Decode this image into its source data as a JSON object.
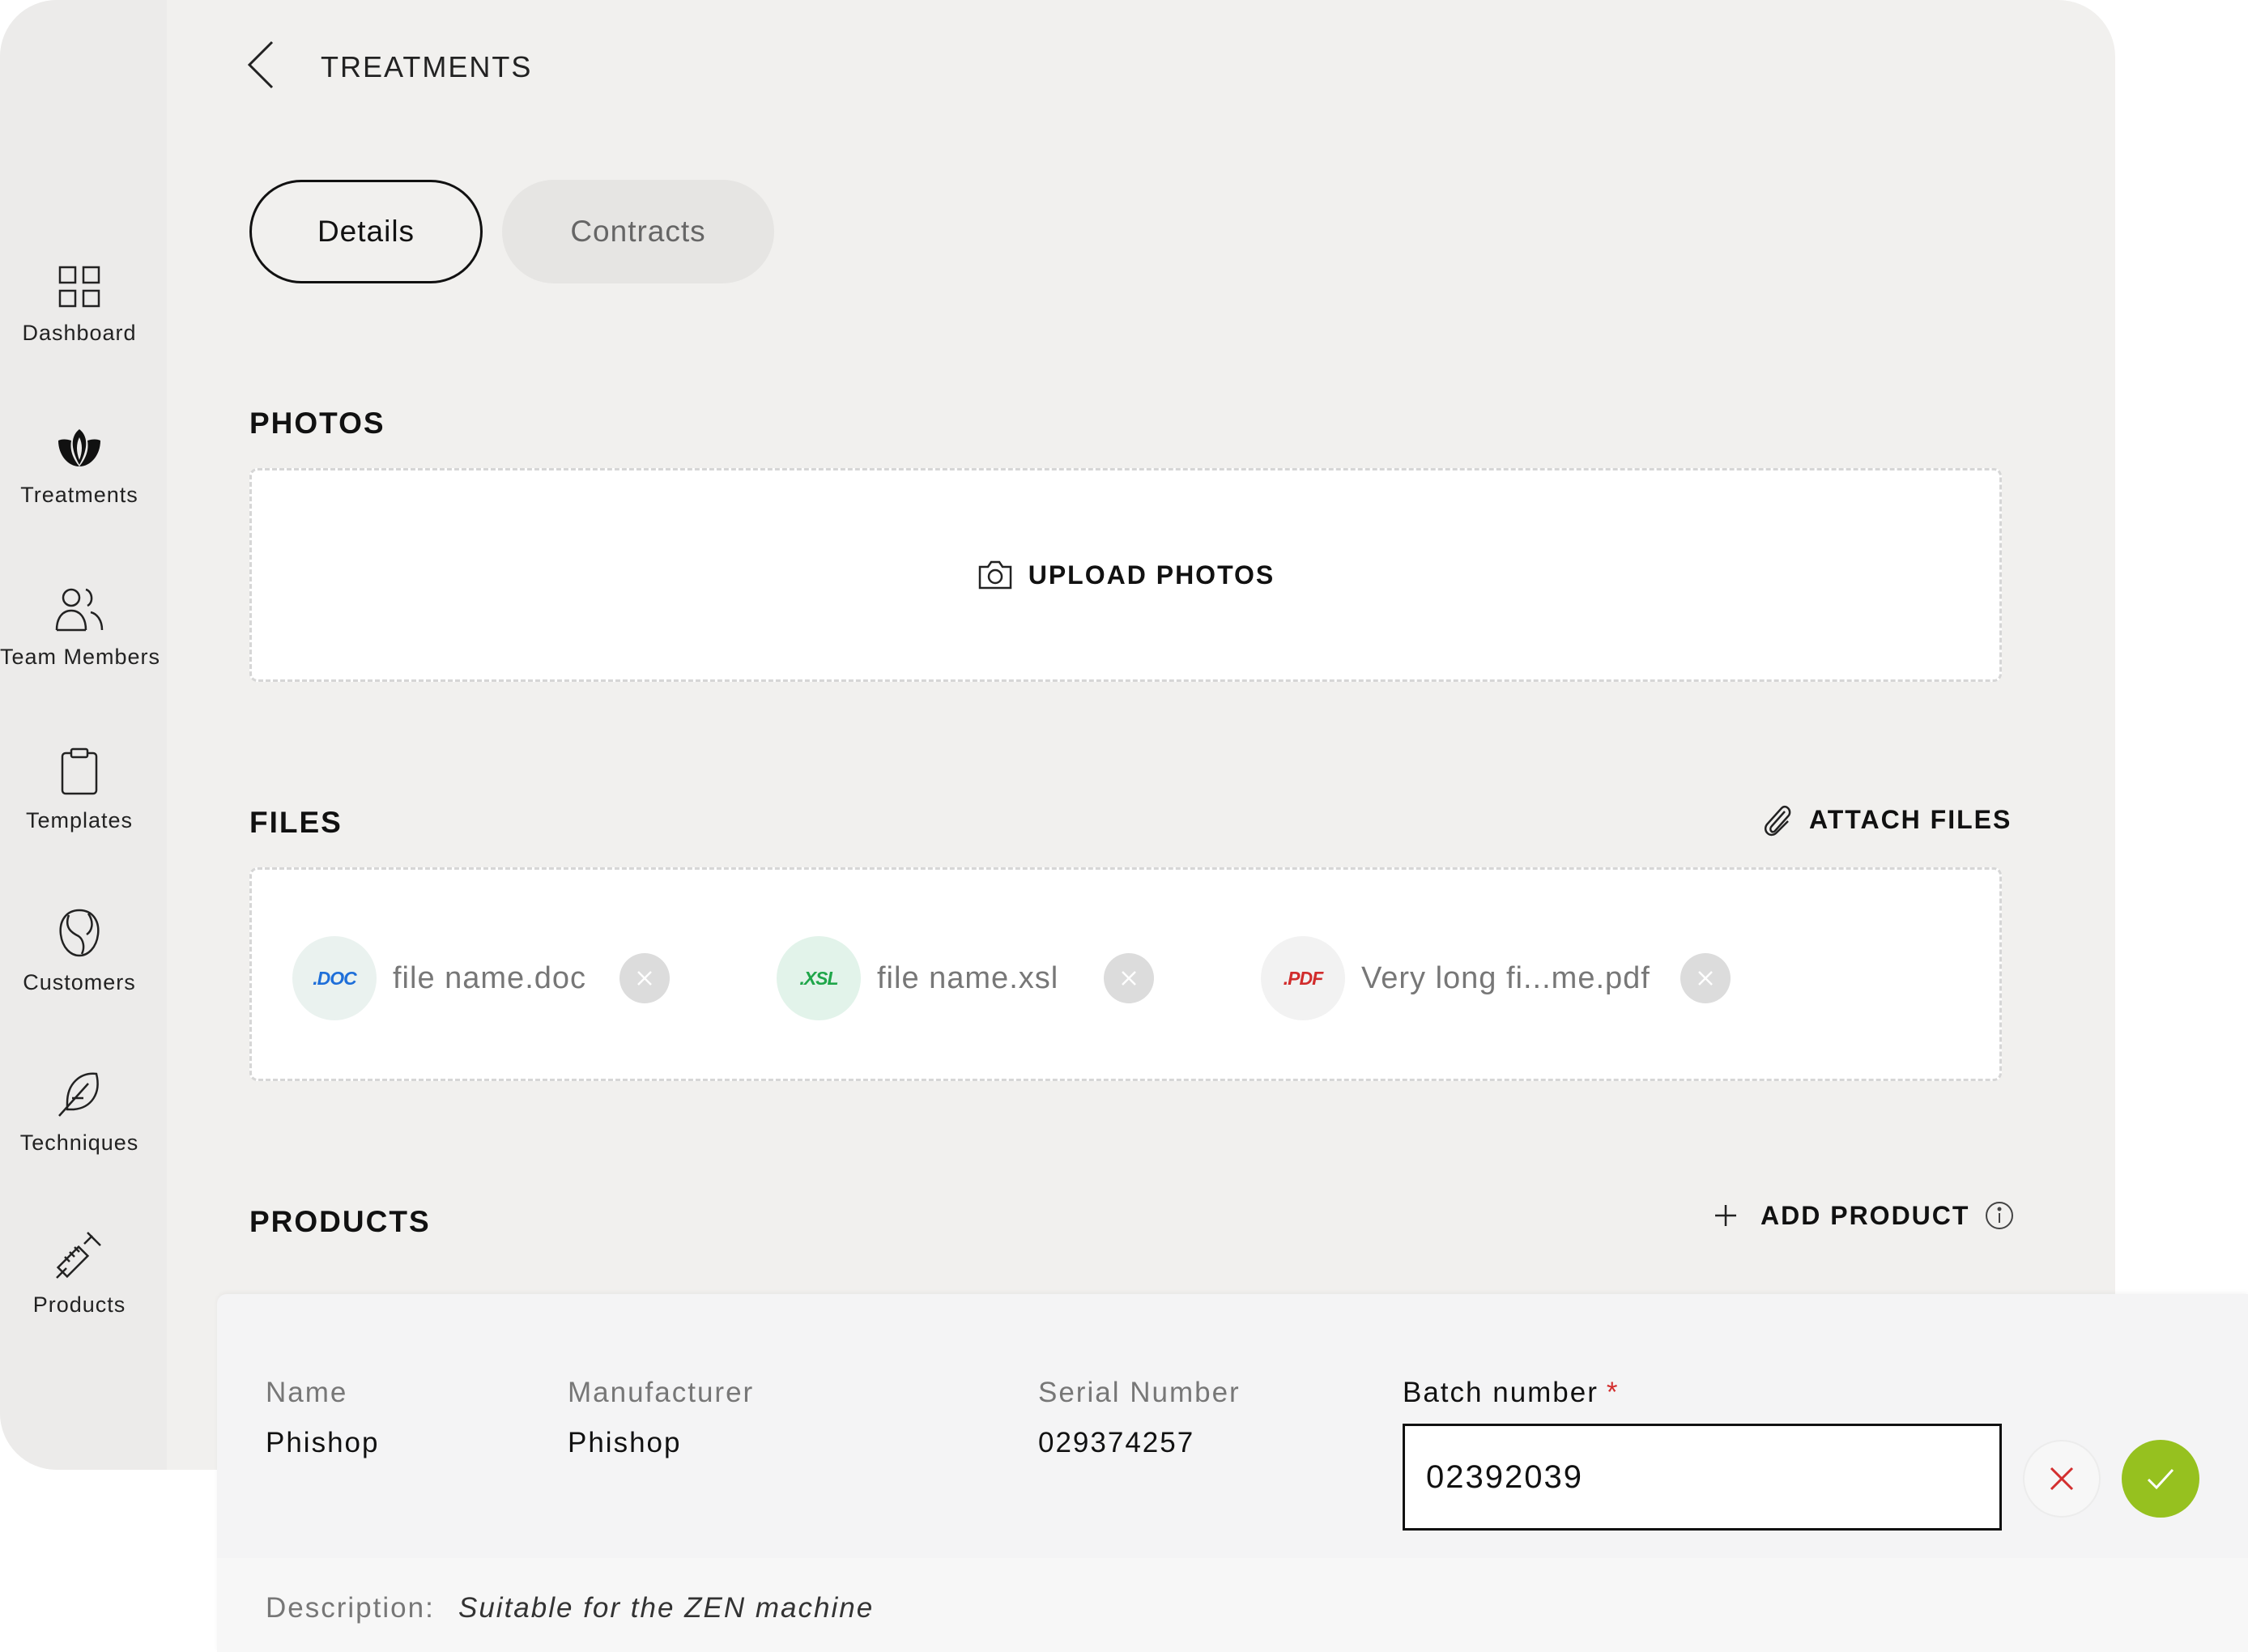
{
  "header": {
    "title": "TREATMENTS"
  },
  "sidebar": {
    "items": [
      {
        "label": "Dashboard",
        "icon": "grid-icon"
      },
      {
        "label": "Treatments",
        "icon": "lotus-icon"
      },
      {
        "label": "Team Members",
        "icon": "users-icon"
      },
      {
        "label": "Templates",
        "icon": "clipboard-icon"
      },
      {
        "label": "Customers",
        "icon": "face-icon"
      },
      {
        "label": "Techniques",
        "icon": "feather-icon"
      },
      {
        "label": "Products",
        "icon": "syringe-icon"
      }
    ]
  },
  "tabs": [
    {
      "label": "Details",
      "active": true
    },
    {
      "label": "Contracts",
      "active": false
    }
  ],
  "photos": {
    "title": "PHOTOS",
    "upload_label": "UPLOAD PHOTOS"
  },
  "files": {
    "title": "FILES",
    "attach_label": "ATTACH FILES",
    "items": [
      {
        "badge": ".DOC",
        "name": "file name.doc",
        "color": "#1e6fd9",
        "bg": "#eaf2ef"
      },
      {
        "badge": ".XSL",
        "name": "file name.xsl",
        "color": "#1fa64a",
        "bg": "#e2f3ea"
      },
      {
        "badge": ".PDF",
        "name": "Very long fi...me.pdf",
        "color": "#d12c2c",
        "bg": "#f2f2f2"
      }
    ]
  },
  "products": {
    "title": "PRODUCTS",
    "add_label": "ADD PRODUCT",
    "columns": {
      "name": "Name",
      "manufacturer": "Manufacturer",
      "serial": "Serial Number",
      "batch": "Batch number"
    },
    "row": {
      "name": "Phishop",
      "manufacturer": "Phishop",
      "serial": "029374257",
      "batch": "02392039"
    },
    "description_label": "Description:",
    "description": "Suitable for the ZEN machine",
    "required_mark": "*"
  },
  "colors": {
    "confirm": "#96c11f",
    "cancel_x": "#d32f2f",
    "background": "#f1f0ee"
  }
}
